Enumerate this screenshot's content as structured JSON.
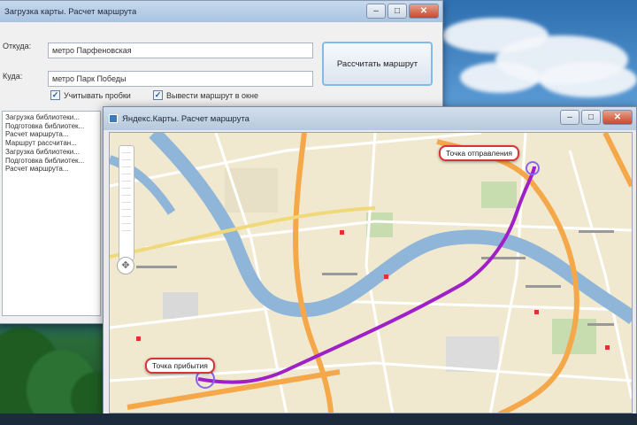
{
  "main_window": {
    "title": "Загрузка карты. Расчет маршрута",
    "from_label": "Откуда:",
    "from_value": "метро Парфеновская",
    "to_label": "Куда:",
    "to_value": "метро Парк Победы",
    "calc_button_label": "Рассчитать маршрут",
    "checkbox_traffic_label": "Учитывать пробки",
    "checkbox_traffic_checked": true,
    "checkbox_show_label": "Вывести маршрут в окне",
    "checkbox_show_checked": true,
    "log_lines": [
      "Загрузка библиотеки...",
      "Подготовка библиотек...",
      "Расчет маршрута...",
      "Маршрут рассчитан...",
      "Загрузка библиотеки...",
      "Подготовка библиотек...",
      "Расчет маршрута..."
    ]
  },
  "map_window": {
    "title": "Яндекс.Карты. Расчет маршрута",
    "callout_start": "Точка отправления",
    "callout_end": "Точка прибытия",
    "route_color": "#a020c8"
  },
  "colors": {
    "river": "#8fb5d8",
    "major_road": "#f5a84a",
    "minor_road": "#ffffff",
    "park": "#c7ddb0"
  }
}
